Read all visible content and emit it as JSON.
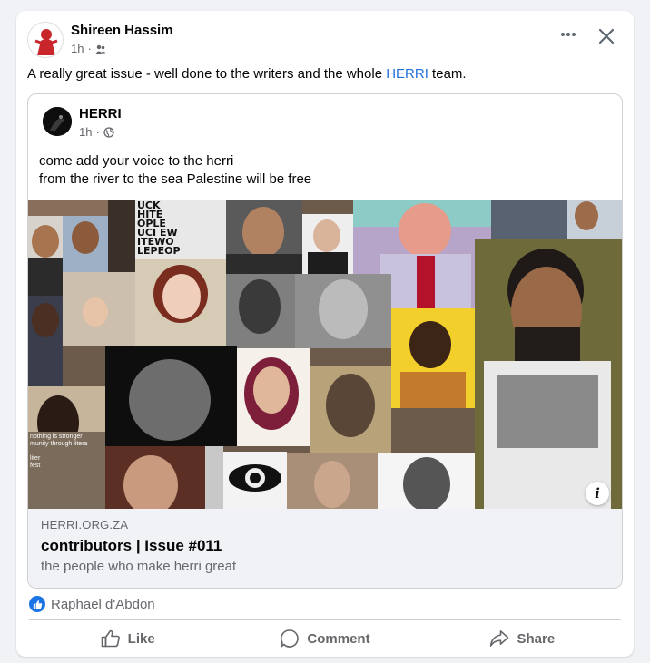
{
  "post": {
    "author": "Shireen Hassim",
    "time": "1h",
    "separator": "·",
    "text_before": "A really great issue - well done to the writers and the whole ",
    "text_link": "HERRI",
    "text_after": " team."
  },
  "shared_post": {
    "author": "HERRI",
    "time": "1h",
    "separator": "·",
    "line1": "come add your voice to the herri",
    "line2": "from the river to the sea Palestine will be free"
  },
  "link_preview": {
    "domain": "HERRI.ORG.ZA",
    "title": "contributors | Issue #011",
    "description": "the people who make herri great"
  },
  "collage_text": [
    "UCK",
    "HITE",
    "OPLE",
    "UCI",
    "EW",
    "ITEWO",
    "LEPEOP",
    "nothing is stronger",
    "munity through litera",
    "liter",
    "fest"
  ],
  "reactions": {
    "names": "Raphael d'Abdon"
  },
  "actions": {
    "like": "Like",
    "comment": "Comment",
    "share": "Share"
  },
  "icons": [
    "more-icon",
    "close-icon",
    "friends-audience-icon",
    "globe-icon",
    "info-icon",
    "like-reaction-icon",
    "thumbs-up-icon",
    "comment-icon",
    "share-icon"
  ],
  "colors": {
    "link": "#216fdb",
    "like_blue": "#1b74e4",
    "meta_gray": "#65676b",
    "preview_bg": "#f0f2f5"
  }
}
